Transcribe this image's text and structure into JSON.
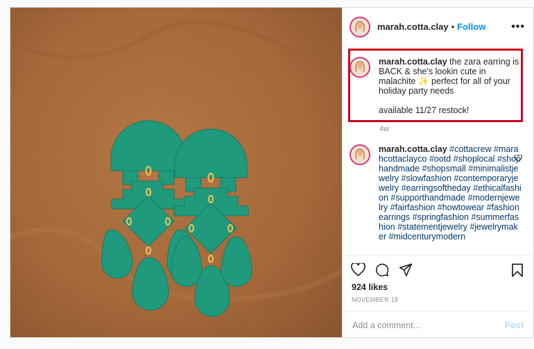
{
  "post": {
    "username": "marah.cotta.clay",
    "separator": "•",
    "follow_label": "Follow",
    "more_label": "•••",
    "caption": {
      "username": "marah.cotta.clay",
      "text": " the zara earring is BACK & she's lookin cute in malachite ✨ perfect for all of your holiday party needs\n\navailable 11/27 restock!"
    },
    "time_ago": "4w",
    "comment": {
      "username": "marah.cotta.clay",
      "text": " #cottacrew #marahcottaclayco #ootd #shoplocal #shophandmade #shopsmall #minimalistjewelry #slowfashion #contemporaryjewelry #earringsoftheday #ethicalfashion #supporthandmade #modernjewelry #fairfashion #howtowear #fashionearrings #springfashion #summerfashion #statementjewelry #jewelrymaker #midcenturymodern"
    },
    "likes": "924 likes",
    "date": "NOVEMBER 18",
    "add_comment_placeholder": "Add a comment...",
    "post_label": "Post"
  },
  "icons": {
    "like": "heart-icon",
    "comment": "comment-icon",
    "share": "share-icon",
    "save": "bookmark-icon",
    "more": "more-icon"
  },
  "colors": {
    "follow": "#0095f6",
    "highlight_border": "#d0021b",
    "earring": "#1f9a7c",
    "fabric": "#a86a3a",
    "post_disabled": "#b2dffc"
  }
}
